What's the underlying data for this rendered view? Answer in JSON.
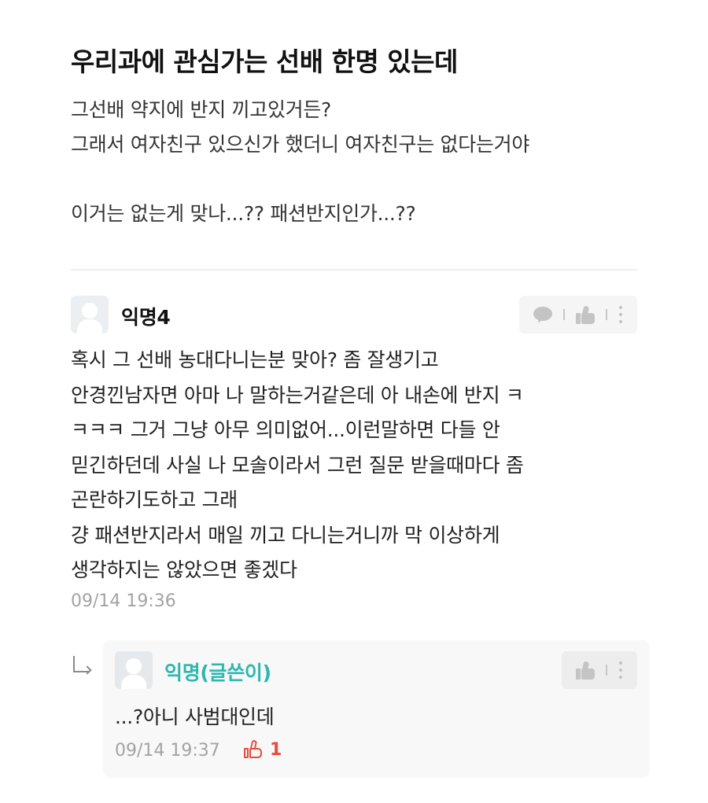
{
  "post": {
    "title": "우리과에 관심가는 선배 한명 있는데",
    "body_lines": [
      "그선배 약지에 반지 끼고있거든?",
      "그래서 여자친구 있으신가 했더니 여자친구는 없다는거야",
      "",
      "이거는 없는게 맞나...?? 패션반지인가...??"
    ]
  },
  "comment": {
    "author": "익명4",
    "text_lines": [
      "혹시 그 선배 농대다니는분 맞아? 좀 잘생기고",
      "안경낀남자면 아마 나 말하는거같은데 아 내손에 반지 ㅋ",
      "ㅋㅋㅋ 그거 그냥 아무 의미없어...이런말하면 다들 안",
      "믿긴하던데 사실 나 모솔이라서 그런 질문 받을때마다 좀",
      "곤란하기도하고 그래",
      "걍 패션반지라서 매일 끼고 다니는거니까 막 이상하게",
      "생각하지는 않았으면 좋겠다"
    ],
    "time": "09/14 19:36",
    "actions": {
      "reply_icon": "chat-icon",
      "like_icon": "thumbs-up-icon",
      "more_icon": "more-vertical-icon"
    }
  },
  "reply": {
    "author": "익명(글쓴이)",
    "author_color": "#2db7b0",
    "text": "...?아니 사범대인데",
    "time": "09/14 19:37",
    "likes": "1",
    "like_color": "#e84a3c",
    "actions": {
      "like_icon": "thumbs-up-icon",
      "more_icon": "more-vertical-icon"
    }
  }
}
